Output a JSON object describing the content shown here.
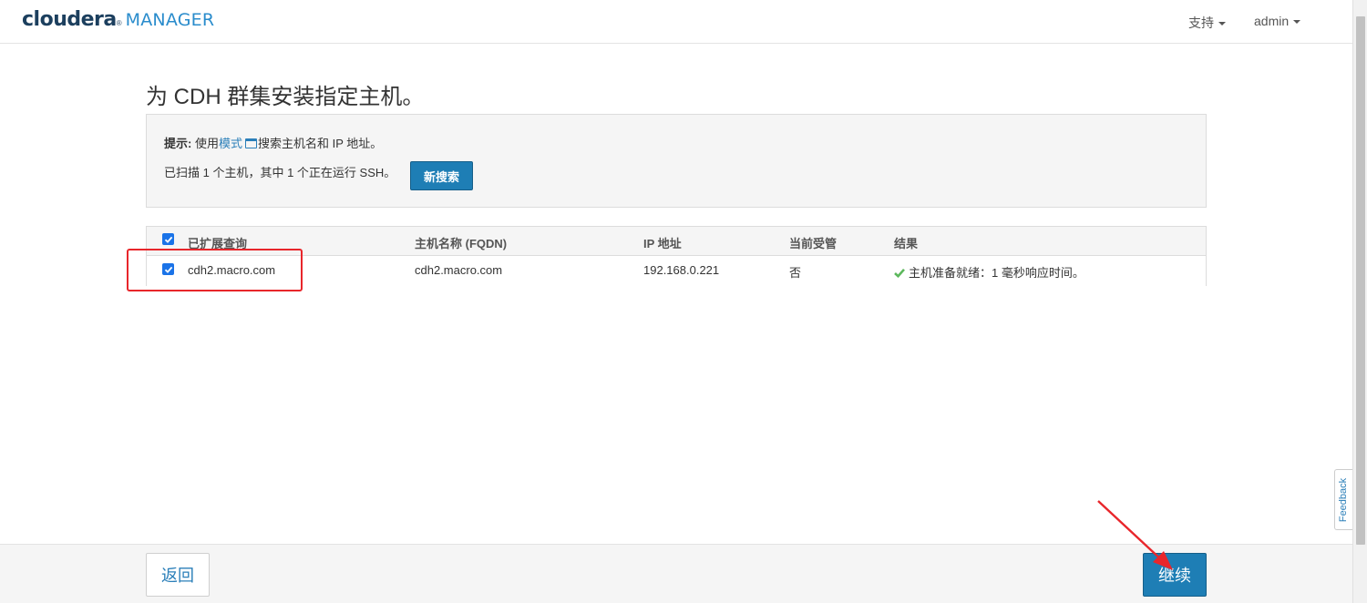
{
  "header": {
    "logo_cloudera": "cloudera",
    "logo_reg": "®",
    "logo_manager": "MANAGER",
    "support_menu": "支持",
    "user_menu": "admin"
  },
  "page": {
    "title": "为 CDH 群集安装指定主机。"
  },
  "info": {
    "hint_label": "提示:",
    "hint_prefix": " 使用",
    "hint_link": "模式",
    "hint_suffix": "搜索主机名和 IP 地址。",
    "scan_status": "已扫描 1 个主机，其中 1 个正在运行 SSH。",
    "new_search_button": "新搜索"
  },
  "table": {
    "columns": [
      "已扩展查询",
      "主机名称 (FQDN)",
      "IP 地址",
      "当前受管",
      "结果"
    ],
    "rows": [
      {
        "checked": true,
        "query": "cdh2.macro.com",
        "fqdn": "cdh2.macro.com",
        "ip": "192.168.0.221",
        "managed": "否",
        "result": "主机准备就绪：1 毫秒响应时间。"
      }
    ]
  },
  "feedback_label": "Feedback",
  "footer": {
    "back_button": "返回",
    "continue_button": "继续"
  },
  "colors": {
    "brand_dark": "#1c3f5e",
    "brand_light": "#2a8ccc",
    "primary_button": "#1e7eb5",
    "annotation_red": "#e8262b",
    "success_green": "#5cb85c"
  },
  "icons": {
    "pattern_link_icon": "window-icon",
    "result_icon": "checkmark-icon",
    "menu_caret": "caret-down-icon"
  }
}
